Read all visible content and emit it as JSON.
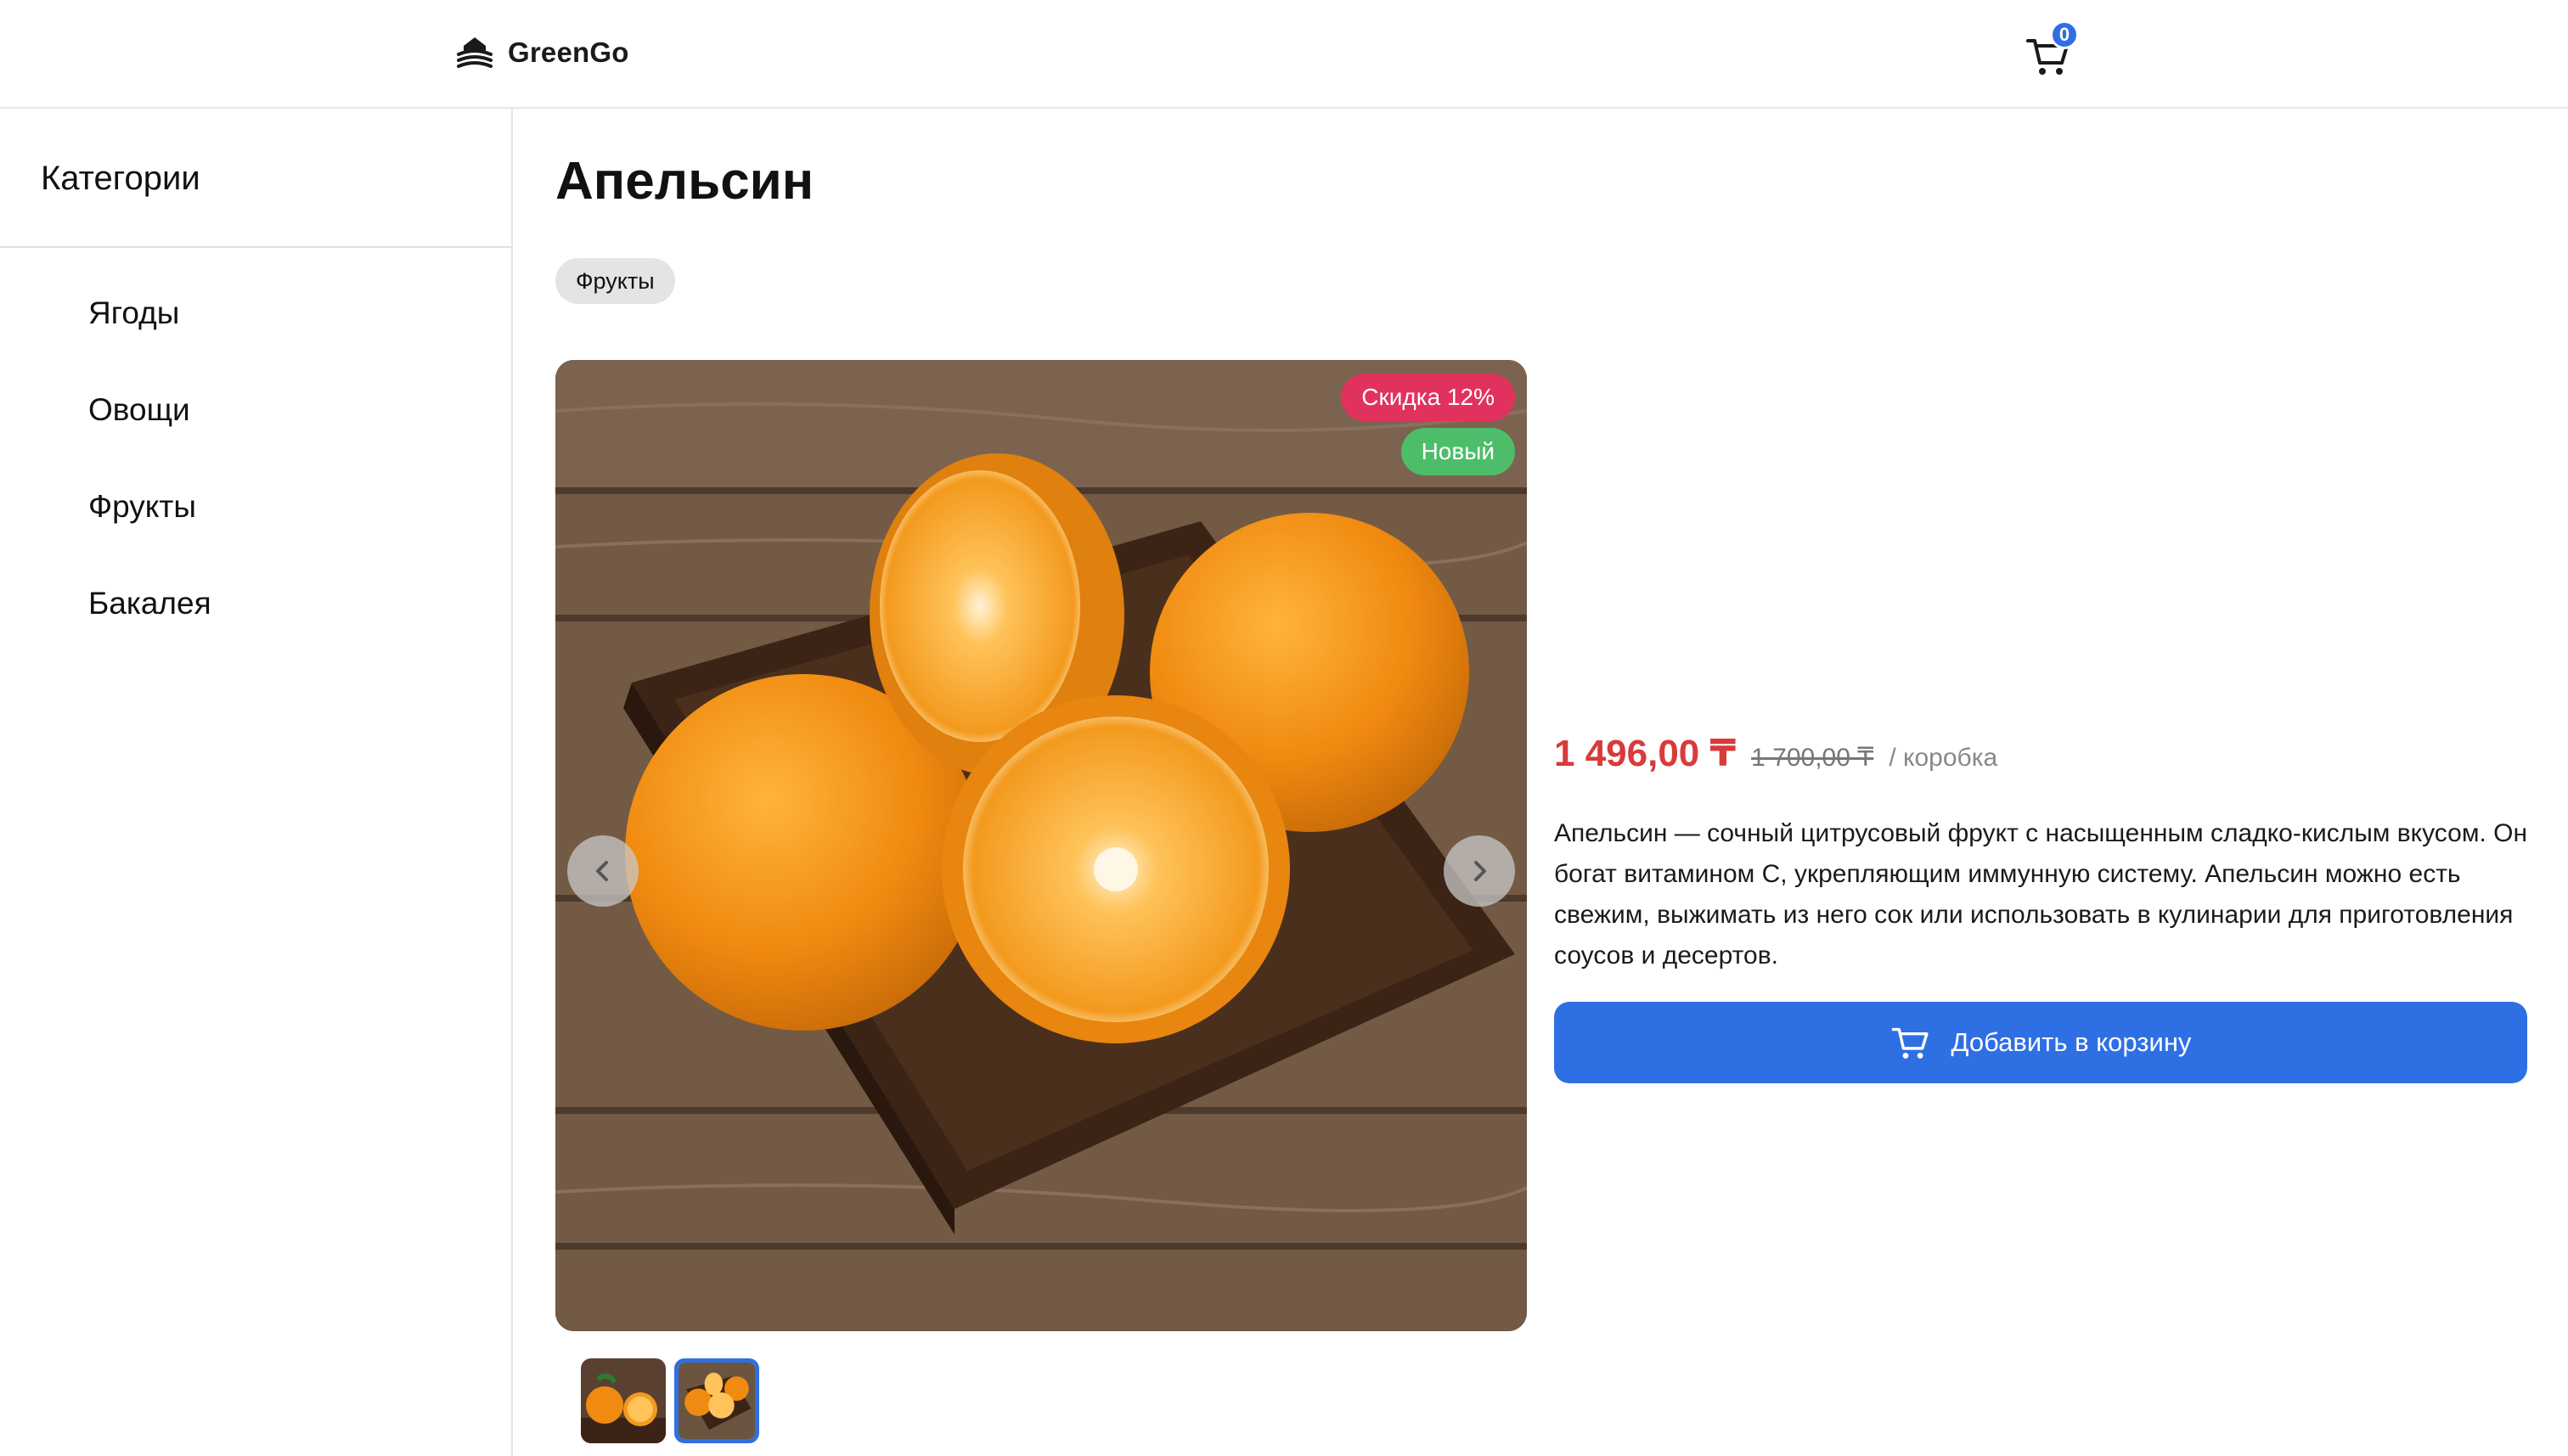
{
  "brand": {
    "name": "GreenGo"
  },
  "cart": {
    "count": "0"
  },
  "sidebar": {
    "title": "Категории",
    "items": [
      {
        "label": "Ягоды"
      },
      {
        "label": "Овощи"
      },
      {
        "label": "Фрукты"
      },
      {
        "label": "Бакалея"
      }
    ]
  },
  "product": {
    "title": "Апельсин",
    "tag": "Фрукты",
    "badges": {
      "sale": "Скидка 12%",
      "new": "Новый"
    },
    "price": "1 496,00 ₸",
    "old_price": "1 700,00 ₸",
    "unit": "/ коробка",
    "description": "Апельсин — сочный цитрусовый фрукт с насыщенным сладко-кислым вкусом. Он богат витамином С, укрепляющим иммунную систему. Апельсин можно есть свежим, выжимать из него сок или использовать в кулинарии для приготовления соусов и десертов.",
    "add_to_cart_label": "Добавить в корзину",
    "gallery": {
      "active_index": 2,
      "total": 2
    }
  },
  "colors": {
    "accent": "#2f6fe4",
    "price": "#d93a3a",
    "sale_badge": "#e1325e",
    "new_badge": "#4dbd6a"
  }
}
